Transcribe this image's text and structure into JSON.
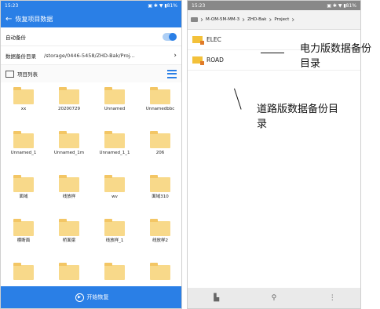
{
  "left_screen": {
    "status": {
      "time": "15:23",
      "icons": "▣ ✱ ▼ ▮81%"
    },
    "appbar": {
      "title": "恢复项目数据"
    },
    "auto_backup": {
      "label": "自动备份"
    },
    "backup_dir": {
      "label": "数据备份目录",
      "path": "/storage/0446-5458/ZHD-Bak/Proj..."
    },
    "project_list": {
      "label": "项目列表"
    },
    "folders": [
      "xx",
      "20200729",
      "Unnamed",
      "Unnamedbbc",
      "Unnamed_1",
      "Unnamed_1m",
      "Unnamed_1_1",
      "206",
      "面域",
      "线放样",
      "wv",
      "面域310",
      "横断面",
      "桥面梁",
      "线放样_1",
      "线放样2",
      "",
      "",
      "",
      ""
    ],
    "bottom_button": {
      "label": "开始恢复"
    }
  },
  "right_screen": {
    "status": {
      "time": "15:23",
      "icons": "▣ ✱ ▼ ▮81%"
    },
    "breadcrumbs": [
      "M-OM-5M-MM-3",
      "ZHD-Bak",
      "Project"
    ],
    "folders": [
      "ELEC",
      "ROAD"
    ],
    "bottom_icons": [
      "▙",
      "⚲",
      "⋮"
    ]
  },
  "annotations": {
    "elec": "电力版数据备份目录",
    "road": "道路版数据备份目录"
  }
}
